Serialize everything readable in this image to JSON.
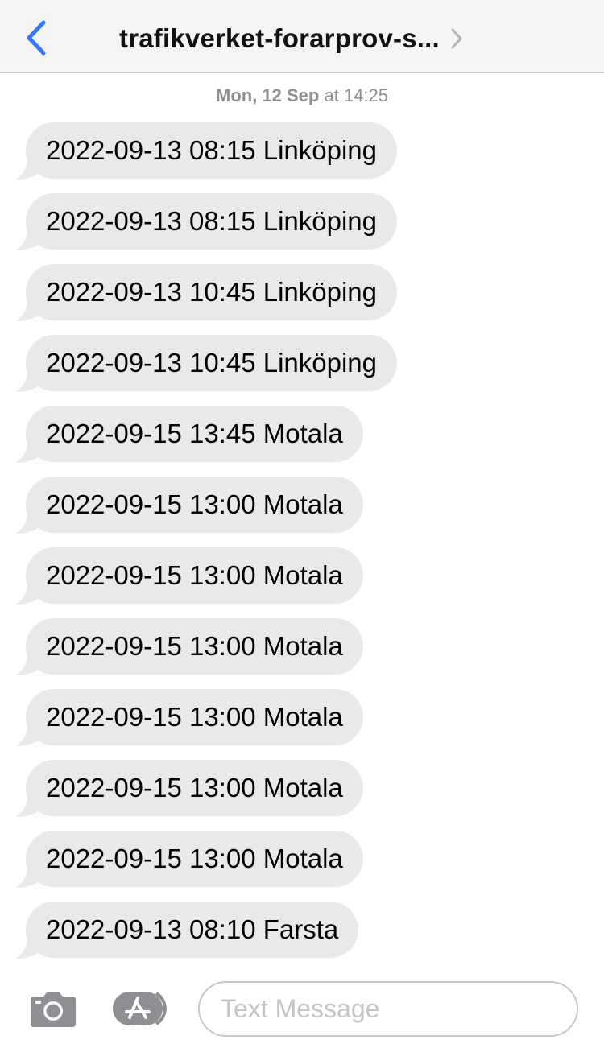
{
  "header": {
    "title": "trafikverket-forarprov-s..."
  },
  "timestamp": {
    "day": "Mon, 12 Sep",
    "time": "at 14:25"
  },
  "messages": [
    {
      "text": "2022-09-13 08:15 Linköping"
    },
    {
      "text": "2022-09-13 08:15 Linköping"
    },
    {
      "text": "2022-09-13 10:45 Linköping"
    },
    {
      "text": "2022-09-13 10:45 Linköping"
    },
    {
      "text": "2022-09-15 13:45 Motala"
    },
    {
      "text": "2022-09-15 13:00 Motala"
    },
    {
      "text": "2022-09-15 13:00 Motala"
    },
    {
      "text": "2022-09-15 13:00 Motala"
    },
    {
      "text": "2022-09-15 13:00 Motala"
    },
    {
      "text": "2022-09-15 13:00 Motala"
    },
    {
      "text": "2022-09-15 13:00 Motala"
    },
    {
      "text": "2022-09-13 08:10 Farsta"
    }
  ],
  "composer": {
    "placeholder": "Text Message",
    "value": ""
  },
  "icons": {
    "back": "chevron-left-icon",
    "title_chevron": "chevron-right-icon",
    "camera": "camera-icon",
    "apps": "app-store-icon"
  },
  "colors": {
    "accent": "#3478f6",
    "bubble": "#e9e9eb",
    "header_bg": "#f4f4f5",
    "icon_gray": "#8e8e93"
  }
}
